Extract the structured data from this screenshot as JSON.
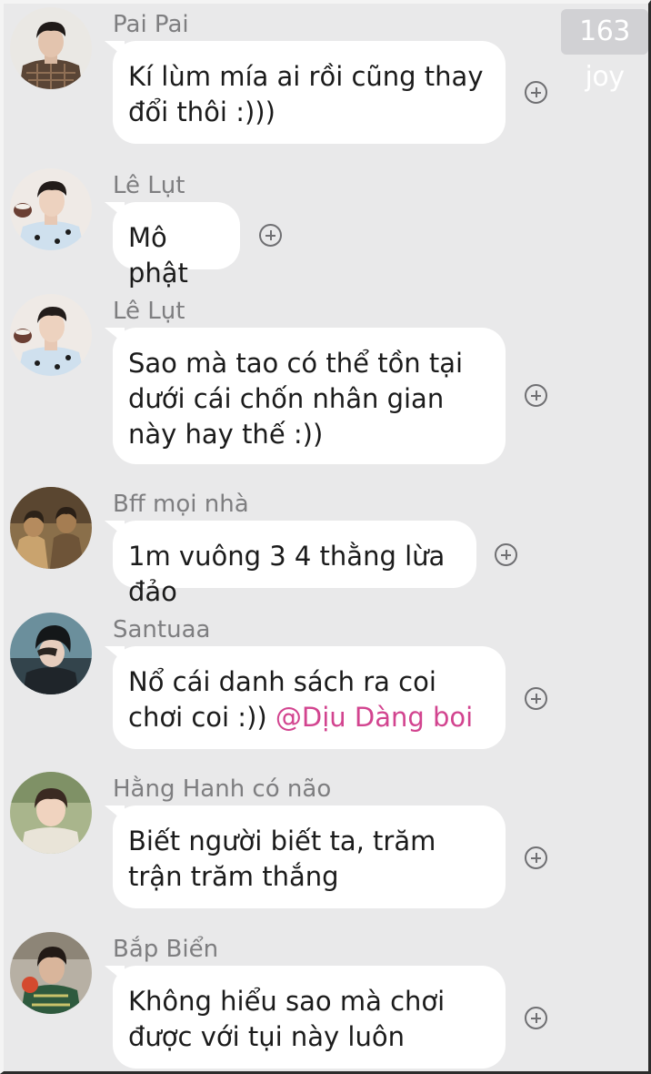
{
  "watermark": {
    "text": "163 joy"
  },
  "messages": [
    {
      "sender": "Pai Pai",
      "avatar_icon": "avatar-man-plaid-jacket",
      "text": "Kí lùm mía ai rồi cũng thay đổi thôi :)))"
    },
    {
      "sender": "Lê Lụt",
      "avatar_icon": "avatar-man-holding-dessert",
      "text": "Mô phật"
    },
    {
      "sender": "Lê Lụt",
      "avatar_icon": "avatar-man-holding-dessert",
      "text": "Sao mà tao có thể tồn tại dưới cái chốn nhân gian này hay thế :))"
    },
    {
      "sender": "Bff mọi nhà",
      "avatar_icon": "avatar-sepia-couple",
      "text": "1m vuông 3 4 thằng lừa đảo"
    },
    {
      "sender": "Santuaa",
      "avatar_icon": "avatar-man-beanie",
      "text": "Nổ cái danh sách ra coi chơi coi :)) ",
      "mention": "@Dịu Dàng boi"
    },
    {
      "sender": "Hằng Hanh có não",
      "avatar_icon": "avatar-boy-outdoor",
      "text": "Biết người biết ta, trăm trận trăm thắng"
    },
    {
      "sender": "Bắp Biển",
      "avatar_icon": "avatar-man-eating",
      "text": "Không hiểu sao mà chơi được với tụi này luôn"
    }
  ],
  "colors": {
    "background": "#e9e9ea",
    "bubble": "#ffffff",
    "sender_name": "#7e7e80",
    "mention": "#d2448f",
    "react_icon": "#6f6f72"
  }
}
